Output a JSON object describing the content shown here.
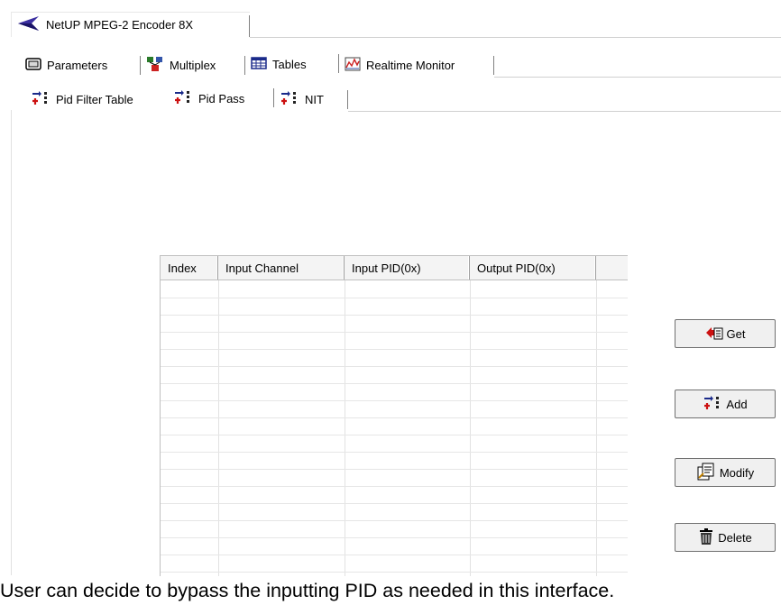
{
  "app_tab": {
    "label": "NetUP MPEG-2 Encoder 8X"
  },
  "main_tabs": [
    {
      "label": "Parameters",
      "icon": "parameters-icon"
    },
    {
      "label": "Multiplex",
      "icon": "multiplex-icon"
    },
    {
      "label": "Tables",
      "icon": "table-icon",
      "selected": true
    },
    {
      "label": "Realtime Monitor",
      "icon": "chart-icon"
    }
  ],
  "sub_tabs": [
    {
      "label": "Pid Filter Table",
      "icon": "pid-icon"
    },
    {
      "label": "Pid Pass",
      "icon": "pid-icon",
      "selected": true
    },
    {
      "label": "NIT",
      "icon": "pid-icon"
    }
  ],
  "table": {
    "columns": [
      "Index",
      "Input Channel",
      "Input PID(0x)",
      "Output PID(0x)",
      ""
    ],
    "rows": []
  },
  "buttons": {
    "get": "Get",
    "add": "Add",
    "modify": "Modify",
    "delete": "Delete"
  },
  "caption": "User can decide to bypass the inputting PID as needed in this interface."
}
